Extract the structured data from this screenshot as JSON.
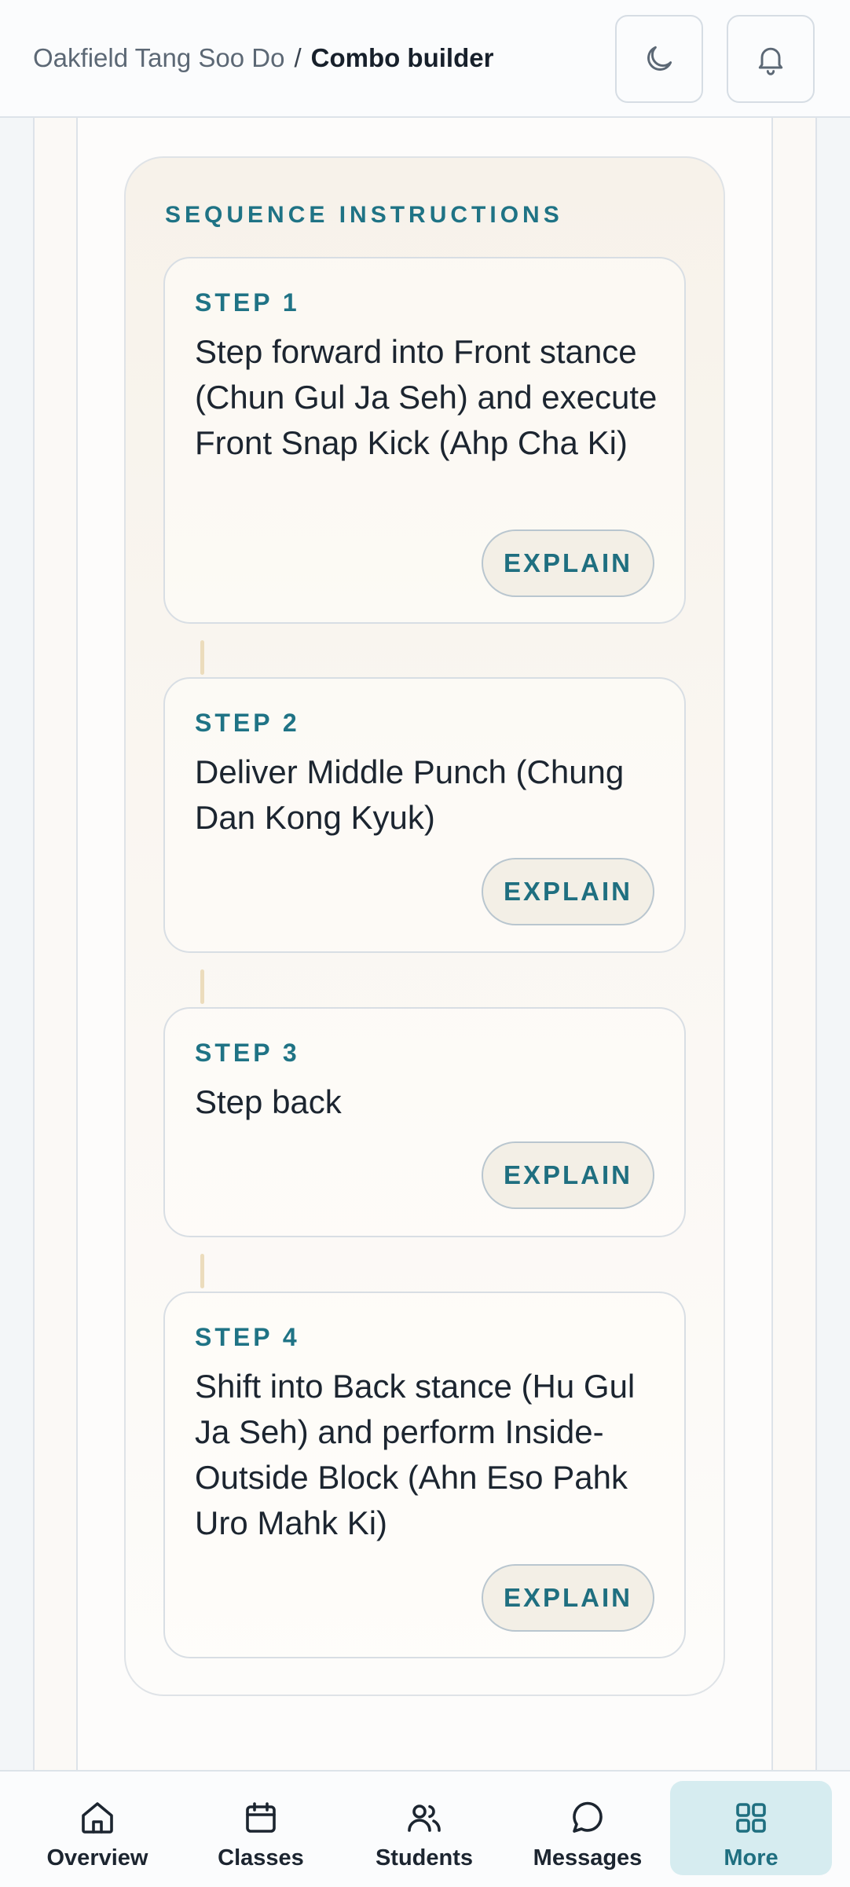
{
  "header": {
    "org_name": "Oakfield Tang Soo Do",
    "separator": "/",
    "current_page": "Combo builder",
    "theme_icon": "moon-icon",
    "notifications_icon": "bell-icon"
  },
  "sequence": {
    "title": "SEQUENCE INSTRUCTIONS",
    "steps": [
      {
        "label": "STEP 1",
        "text": "Step forward into Front stance (Chun Gul Ja Seh) and execute Front Snap Kick (Ahp Cha Ki)",
        "action": "EXPLAIN"
      },
      {
        "label": "STEP 2",
        "text": "Deliver Middle Punch (Chung Dan Kong Kyuk)",
        "action": "EXPLAIN"
      },
      {
        "label": "STEP 3",
        "text": "Step back",
        "action": "EXPLAIN"
      },
      {
        "label": "STEP 4",
        "text": "Shift into Back stance (Hu Gul Ja Seh) and perform Inside-Outside Block (Ahn Eso Pahk Uro Mahk Ki)",
        "action": "EXPLAIN"
      }
    ]
  },
  "nav": {
    "items": [
      {
        "label": "Overview",
        "icon": "home-icon"
      },
      {
        "label": "Classes",
        "icon": "calendar-icon"
      },
      {
        "label": "Students",
        "icon": "users-icon"
      },
      {
        "label": "Messages",
        "icon": "chat-icon"
      },
      {
        "label": "More",
        "icon": "grid-icon",
        "active": true
      }
    ]
  },
  "colors": {
    "accent": "#1f7385",
    "active_nav_bg": "#d6ecf0",
    "connector": "#ecdcbc"
  }
}
